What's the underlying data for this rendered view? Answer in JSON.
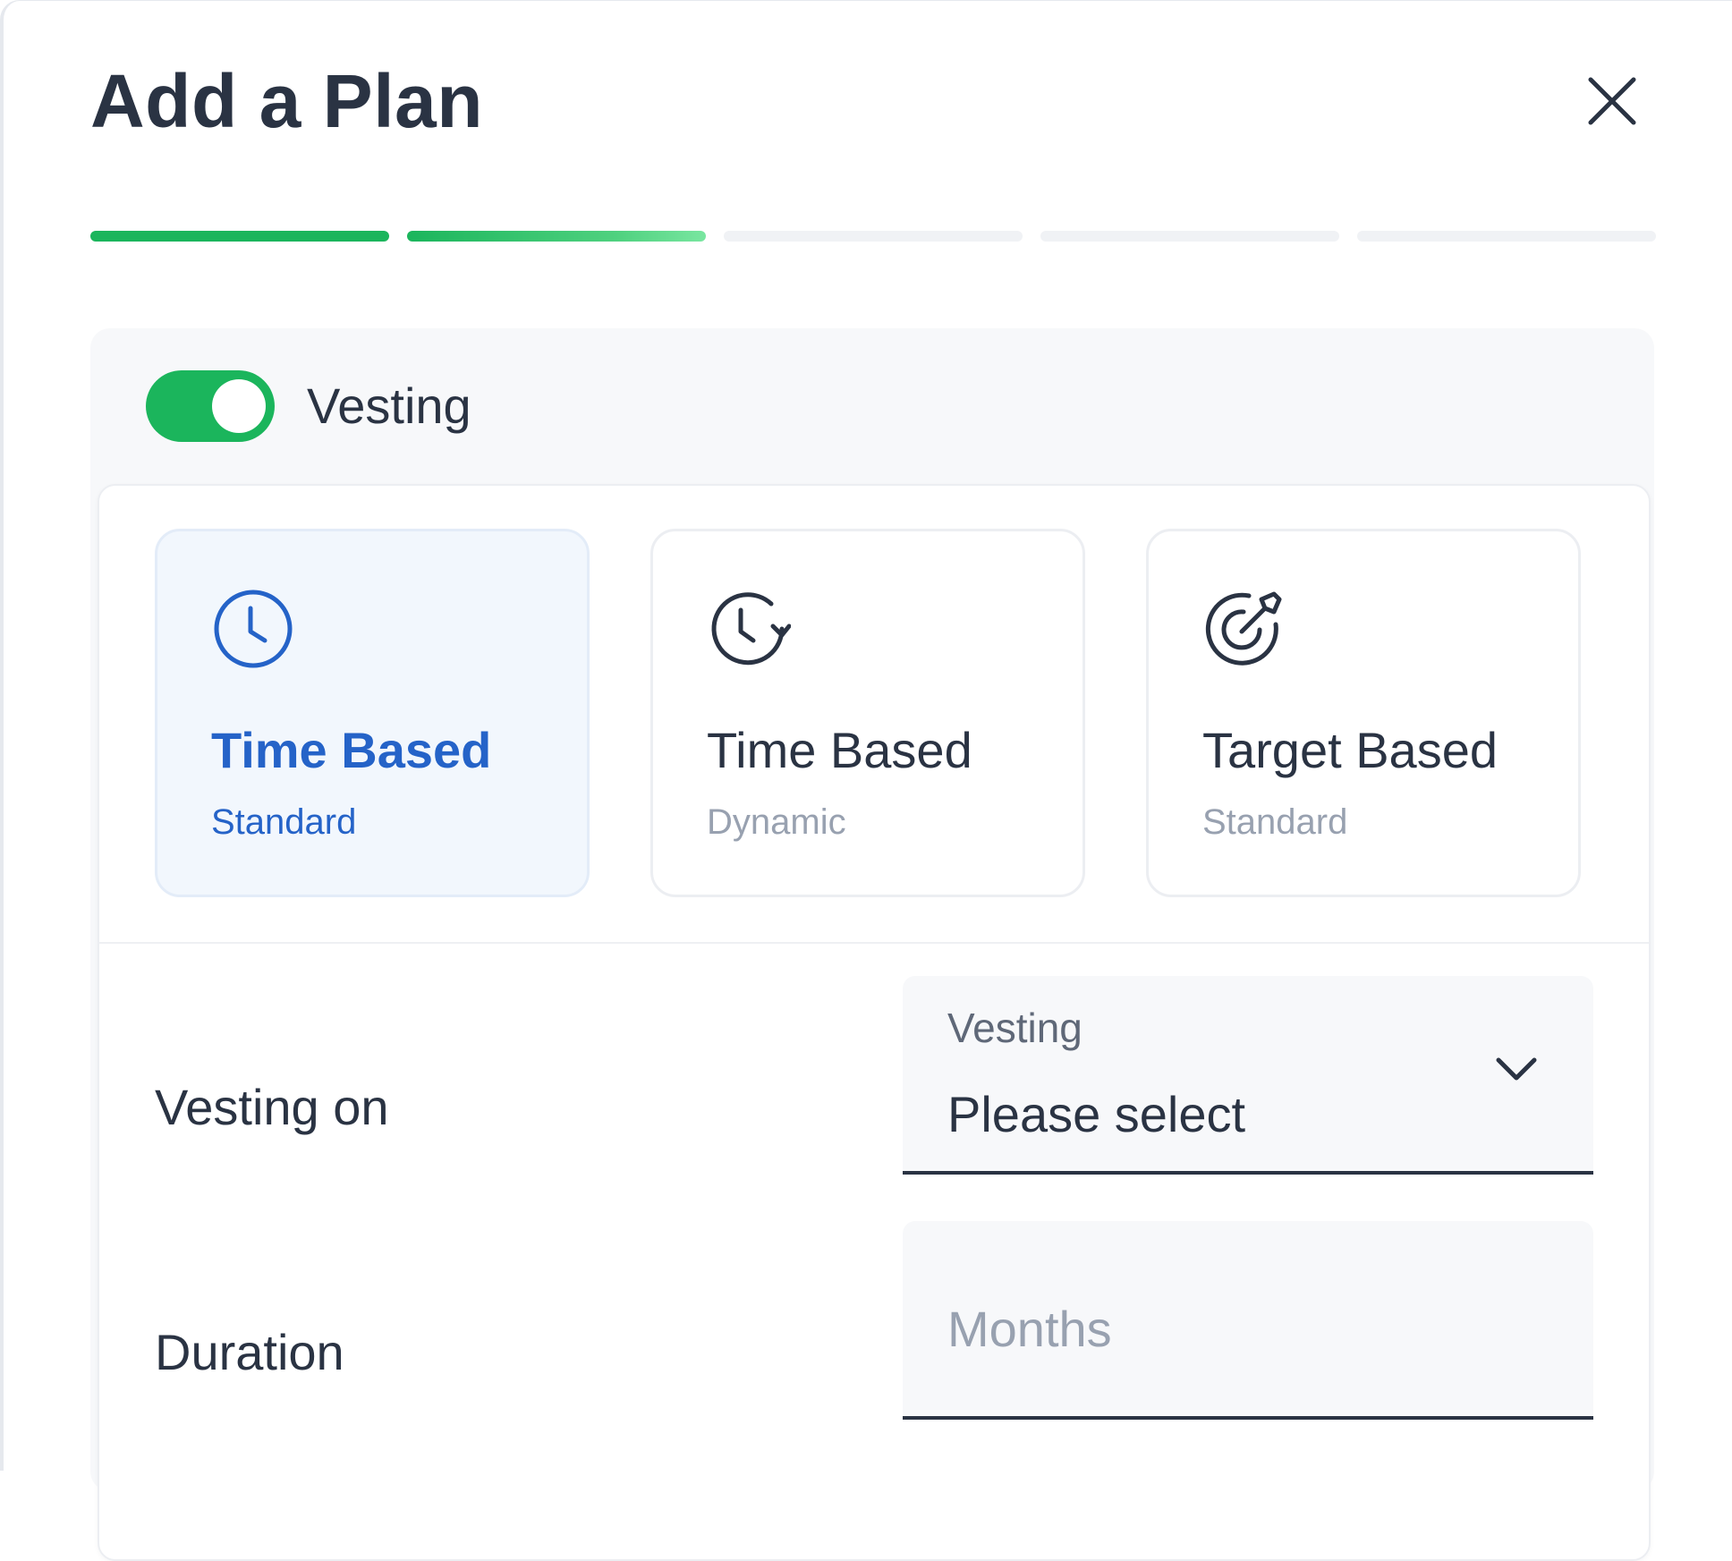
{
  "header": {
    "title": "Add a Plan"
  },
  "progress": {
    "steps_total": 5,
    "steps_completed": 1,
    "current_step": 2
  },
  "vesting_toggle": {
    "label": "Vesting",
    "enabled": true
  },
  "vesting_types": [
    {
      "title": "Time Based",
      "subtitle": "Standard",
      "icon": "clock-icon",
      "selected": true
    },
    {
      "title": "Time Based",
      "subtitle": "Dynamic",
      "icon": "clock-rotate-icon",
      "selected": false
    },
    {
      "title": "Target Based",
      "subtitle": "Standard",
      "icon": "target-arrow-icon",
      "selected": false
    }
  ],
  "form": {
    "vesting_on": {
      "label": "Vesting on",
      "field_label": "Vesting",
      "value": "Please select"
    },
    "duration": {
      "label": "Duration",
      "placeholder": "Months",
      "value": ""
    }
  },
  "colors": {
    "accent_green": "#1bb55c",
    "selected_blue": "#2563c8",
    "text_dark": "#2a3343",
    "text_muted": "#98a1b0"
  }
}
